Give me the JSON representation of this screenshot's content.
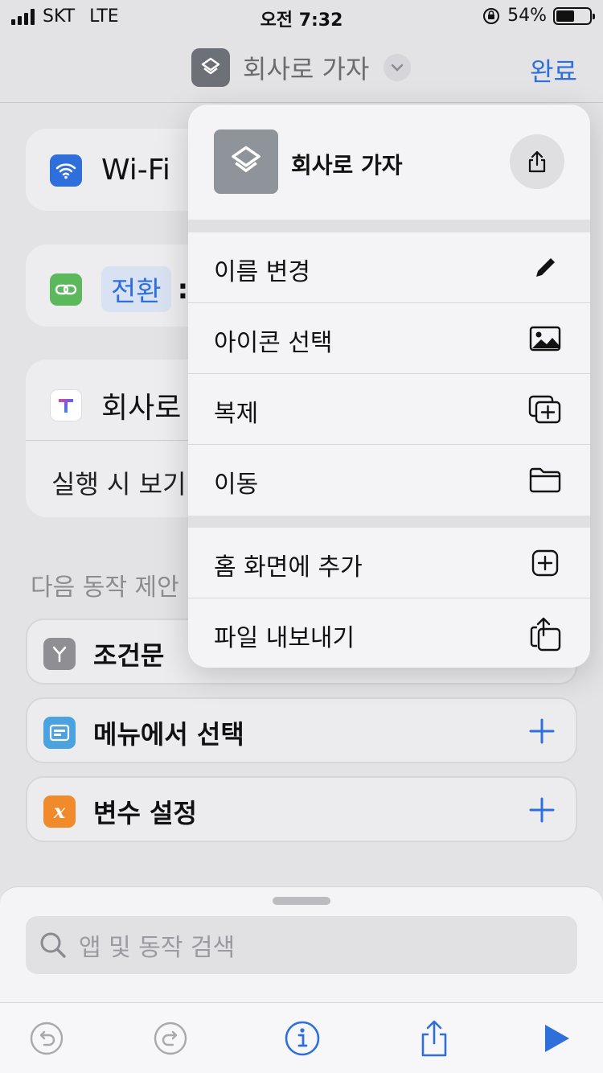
{
  "status_bar": {
    "carrier": "SKT",
    "network": "LTE",
    "time": "오전 7:32",
    "battery": "54%",
    "battery_level": 0.54
  },
  "nav": {
    "title": "회사로 가자",
    "done_label": "완료"
  },
  "actions": {
    "wifi_label": "Wi-Fi",
    "switch_label": "전환",
    "switch_suffix": ":",
    "run_label": "회사로",
    "run_sub": "실행 시 보기"
  },
  "suggestions": {
    "title": "다음 동작 제안",
    "items": [
      {
        "label": "조건문"
      },
      {
        "label": "메뉴에서 선택"
      },
      {
        "label": "변수 설정"
      }
    ]
  },
  "menu": {
    "shortcut_name": "회사로 가자",
    "items": [
      {
        "label": "이름 변경",
        "icon": "pencil-icon"
      },
      {
        "label": "아이콘 선택",
        "icon": "photo-icon"
      },
      {
        "label": "복제",
        "icon": "duplicate-icon"
      },
      {
        "label": "이동",
        "icon": "folder-icon"
      },
      {
        "label": "홈 화면에 추가",
        "icon": "add-square-icon"
      },
      {
        "label": "파일 내보내기",
        "icon": "export-icon"
      }
    ]
  },
  "search": {
    "placeholder": "앱 및 동작 검색"
  },
  "colors": {
    "accent": "#2f6fdc",
    "wifi": "#2f6fdc",
    "link": "#5cb85c",
    "condition": "#8e8e93",
    "menu_blue": "#4aa3df",
    "variable": "#f08a2b"
  }
}
